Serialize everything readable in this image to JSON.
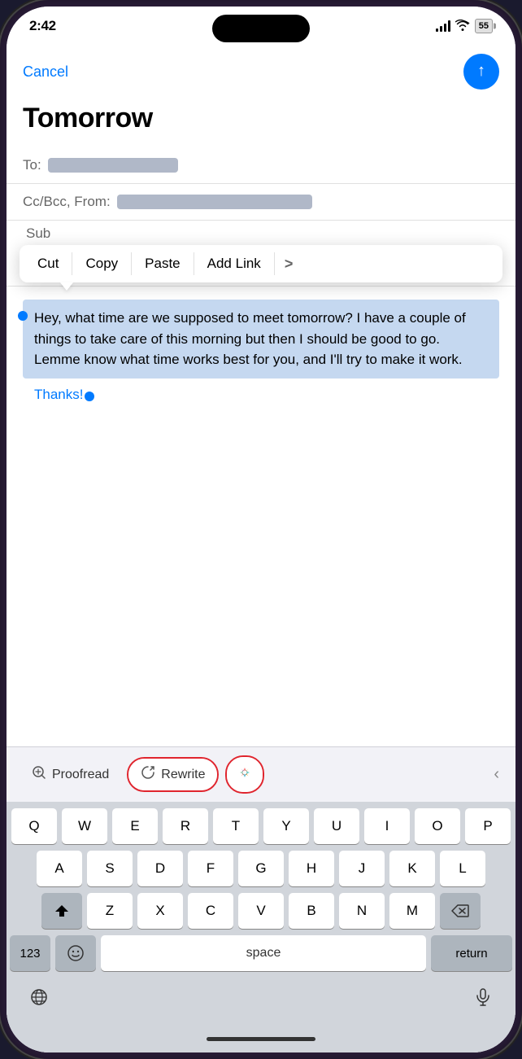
{
  "statusBar": {
    "time": "2:42",
    "batteryLevel": "55"
  },
  "header": {
    "cancelLabel": "Cancel",
    "subjectTitle": "Tomorrow"
  },
  "fields": {
    "toLabel": "To:",
    "ccBccLabel": "Cc/Bcc, From:",
    "subLabel": "Sub"
  },
  "textToolbar": {
    "cut": "Cut",
    "copy": "Copy",
    "paste": "Paste",
    "addLink": "Add Link",
    "moreSymbol": ">"
  },
  "emailBody": {
    "selectedText": "Hey, what time are we supposed to meet tomorrow? I have a couple of things to take care of this morning but then I should be good to go. Lemme know what time works best for you, and I'll try to make it work.",
    "thanksText": "Thanks!"
  },
  "aiTools": {
    "proofreadLabel": "Proofread",
    "rewriteLabel": "Rewrite",
    "chevron": "<"
  },
  "keyboard": {
    "rows": [
      [
        "Q",
        "W",
        "E",
        "R",
        "T",
        "Y",
        "U",
        "I",
        "O",
        "P"
      ],
      [
        "A",
        "S",
        "D",
        "F",
        "G",
        "H",
        "J",
        "K",
        "L"
      ],
      [
        "Z",
        "X",
        "C",
        "V",
        "B",
        "N",
        "M"
      ],
      [
        "123",
        "space",
        "return"
      ]
    ],
    "spaceLabel": "space",
    "returnLabel": "return",
    "numbersLabel": "123"
  }
}
